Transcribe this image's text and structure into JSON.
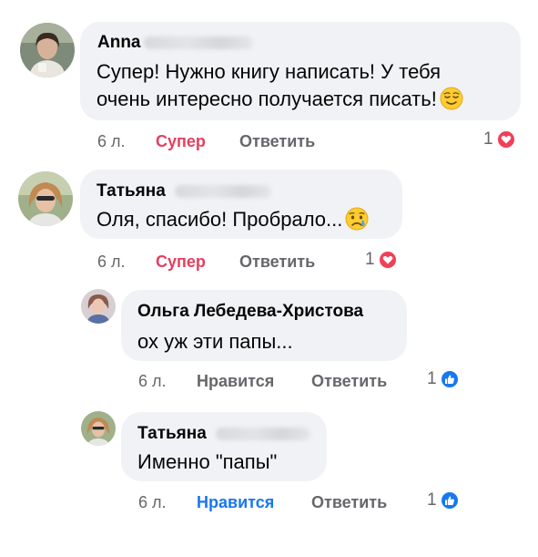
{
  "comments": [
    {
      "author": "Anna",
      "text_line1": "Супер! Нужно книгу написать! У тебя",
      "text_line2": "очень интересно получается писать!",
      "emoji": "relieved-face-emoji",
      "time": "6 л.",
      "reaction_label": "Супер",
      "reply_label": "Ответить",
      "reaction_count": "1",
      "reaction_type": "love-icon"
    },
    {
      "author": "Татьяна",
      "text_line1": "Оля, спасибо! Пробрало...",
      "emoji": "crying-face-emoji",
      "time": "6 л.",
      "reaction_label": "Супер",
      "reply_label": "Ответить",
      "reaction_count": "1",
      "reaction_type": "love-icon"
    },
    {
      "author": "Ольга Лебедева-Христова",
      "text_line1": "ох уж эти папы...",
      "time": "6 л.",
      "reaction_label": "Нравится",
      "reply_label": "Ответить",
      "reaction_count": "1",
      "reaction_type": "like-icon"
    },
    {
      "author": "Татьяна",
      "text_line1": "Именно \"папы\"",
      "time": "6 л.",
      "reaction_label": "Нравится",
      "reply_label": "Ответить",
      "reaction_count": "1",
      "reaction_type": "like-icon"
    }
  ],
  "colors": {
    "bubble": "#f0f2f5",
    "love": "#f33e58",
    "love_label": "#e4405f",
    "like": "#1877f2",
    "muted": "#65676b"
  }
}
